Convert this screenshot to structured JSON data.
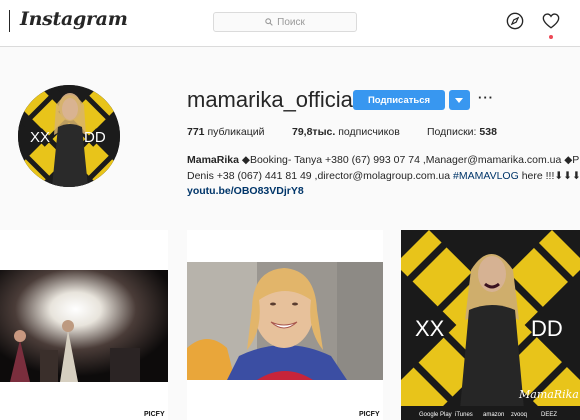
{
  "header": {
    "logo": "Instagram",
    "search_placeholder": "Поиск",
    "icons": [
      "compass-icon",
      "heart-icon"
    ]
  },
  "profile": {
    "username": "mamarika_official",
    "follow_label": "Подписаться",
    "more_label": "···",
    "avatar_text_left": "XX",
    "avatar_text_right": "DD",
    "stats": {
      "posts_count": "771",
      "posts_label": "публикаций",
      "followers_count": "79,8тыс.",
      "followers_label": "подписчиков",
      "following_label": "Подписки:",
      "following_count": "538"
    },
    "bio": {
      "name": "MamaRika",
      "line1_rest": " ◆Booking- Tanya +380 (67) 993 07 74 ,Manager@mamarika.com.ua ◆P",
      "line2_text": "Denis +38 (067) 441 81 49 ,director@molagroup.com.ua ",
      "line2_tag": "#MAMAVLOG",
      "line2_end": " here !!!⬇⬇⬇",
      "link": "youtu.be/OBO83VDjrY8"
    }
  },
  "posts": [
    {
      "type": "concert-photo",
      "watermark": "PICFY"
    },
    {
      "type": "selfie-video",
      "watermark": "PICFY"
    },
    {
      "type": "album-cover",
      "cover_text_left": "XX",
      "cover_text_right": "DD",
      "signature": "MamaRika",
      "footer_items": [
        "Google Play",
        "iTunes",
        "amazon",
        "zvooq",
        "DEEZ"
      ]
    }
  ],
  "colors": {
    "accent": "#3897f0",
    "link": "#003569",
    "notification": "#ed4956",
    "stripe_yellow": "#e8c41a"
  }
}
